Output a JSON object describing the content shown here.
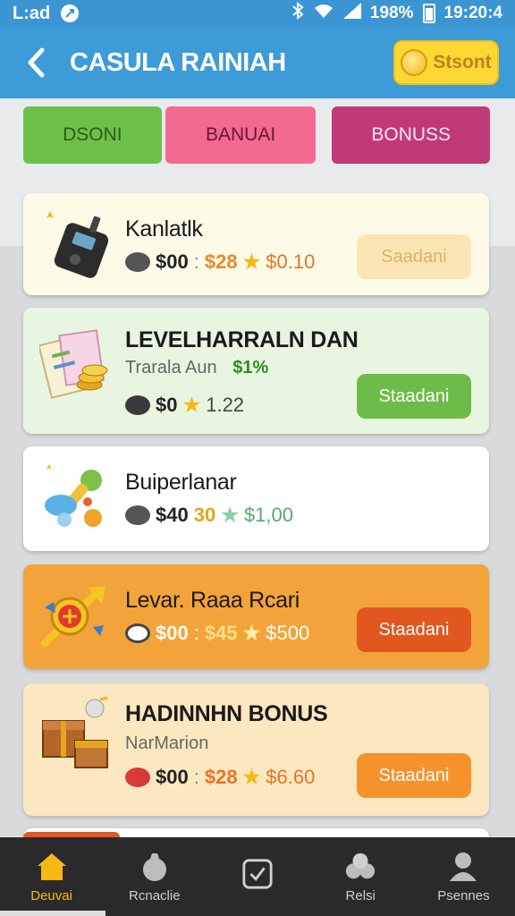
{
  "status_bar": {
    "carrier": "L:ad",
    "battery_percent": "198%",
    "time": "19:20:4"
  },
  "header": {
    "title": "CASULA RAINIAH",
    "start_label": "Stsont"
  },
  "tabs": [
    {
      "label": "DSONI"
    },
    {
      "label": "BANUAI"
    },
    {
      "label": "BONUSS"
    }
  ],
  "cards": [
    {
      "title": "Kanlatlk",
      "icon": "walkie-talkie-icon",
      "price": "$00",
      "separator": ":",
      "old_price": "$28",
      "new_price": "$0.10",
      "button_label": "Saadani"
    },
    {
      "title": "LEVELHARRALN DAN",
      "subtitle": "Trarala Aun",
      "subtitle_extra": "$1%",
      "icon": "coupon-coins-icon",
      "price": "$0",
      "rating": "1.22",
      "button_label": "Staadani"
    },
    {
      "title": "Buiperlanar",
      "icon": "rattle-toy-icon",
      "price": "$40",
      "old_price": "30",
      "new_price": "$1,00"
    },
    {
      "title": "Levar. Raaa Rcari",
      "icon": "arrow-badge-icon",
      "price": "$00",
      "separator": ":",
      "old_price": "$45",
      "new_price": "$500",
      "button_label": "Staadani"
    },
    {
      "title": "HADINNHN BONUS",
      "subtitle": "NarMarion",
      "icon": "treasure-chest-icon",
      "price": "$00",
      "separator": ":",
      "old_price": "$28",
      "new_price": "$6.60",
      "button_label": "Staadani"
    }
  ],
  "bottom_nav": [
    {
      "label": "Deuvai",
      "icon": "home-icon",
      "active": true
    },
    {
      "label": "Rcnaclie",
      "icon": "bag-icon",
      "active": false
    },
    {
      "label": "",
      "icon": "check-square-icon",
      "active": false
    },
    {
      "label": "Relsi",
      "icon": "group-icon",
      "active": false
    },
    {
      "label": "Psennes",
      "icon": "person-icon",
      "active": false
    }
  ],
  "colors": {
    "header": "#3d9bd8",
    "start_button": "#fdd735",
    "tab_green": "#6cc04a",
    "tab_pink": "#f36a91",
    "tab_magenta": "#c13a78",
    "button_green": "#6dbb48",
    "button_red": "#e2561f",
    "button_orange": "#f5922c",
    "star": "#f5b815"
  }
}
